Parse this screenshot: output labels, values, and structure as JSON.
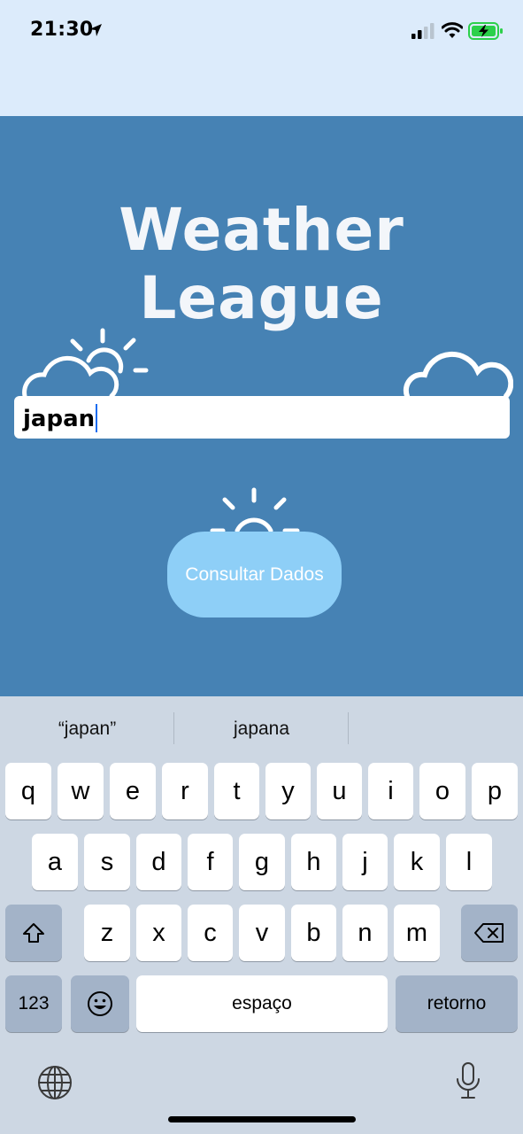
{
  "status_bar": {
    "time": "21:30",
    "icons": [
      "location-arrow-icon",
      "cellular-signal-icon",
      "wifi-icon",
      "battery-charging-icon"
    ]
  },
  "app": {
    "title": "Weather League",
    "search_value": "japan",
    "consult_button": "Consultar Dados"
  },
  "keyboard": {
    "suggestions": [
      "“japan”",
      "japana",
      ""
    ],
    "row1": [
      "q",
      "w",
      "e",
      "r",
      "t",
      "y",
      "u",
      "i",
      "o",
      "p"
    ],
    "row2": [
      "a",
      "s",
      "d",
      "f",
      "g",
      "h",
      "j",
      "k",
      "l"
    ],
    "row3": [
      "z",
      "x",
      "c",
      "v",
      "b",
      "n",
      "m"
    ],
    "numbers_key": "123",
    "space_key": "espaço",
    "return_key": "retorno"
  },
  "colors": {
    "app_bg": "#4682b4",
    "status_bg": "#dcebfb",
    "button_bg": "#8ecff7",
    "keyboard_bg": "#cdd7e3",
    "battery": "#2bd04a"
  }
}
